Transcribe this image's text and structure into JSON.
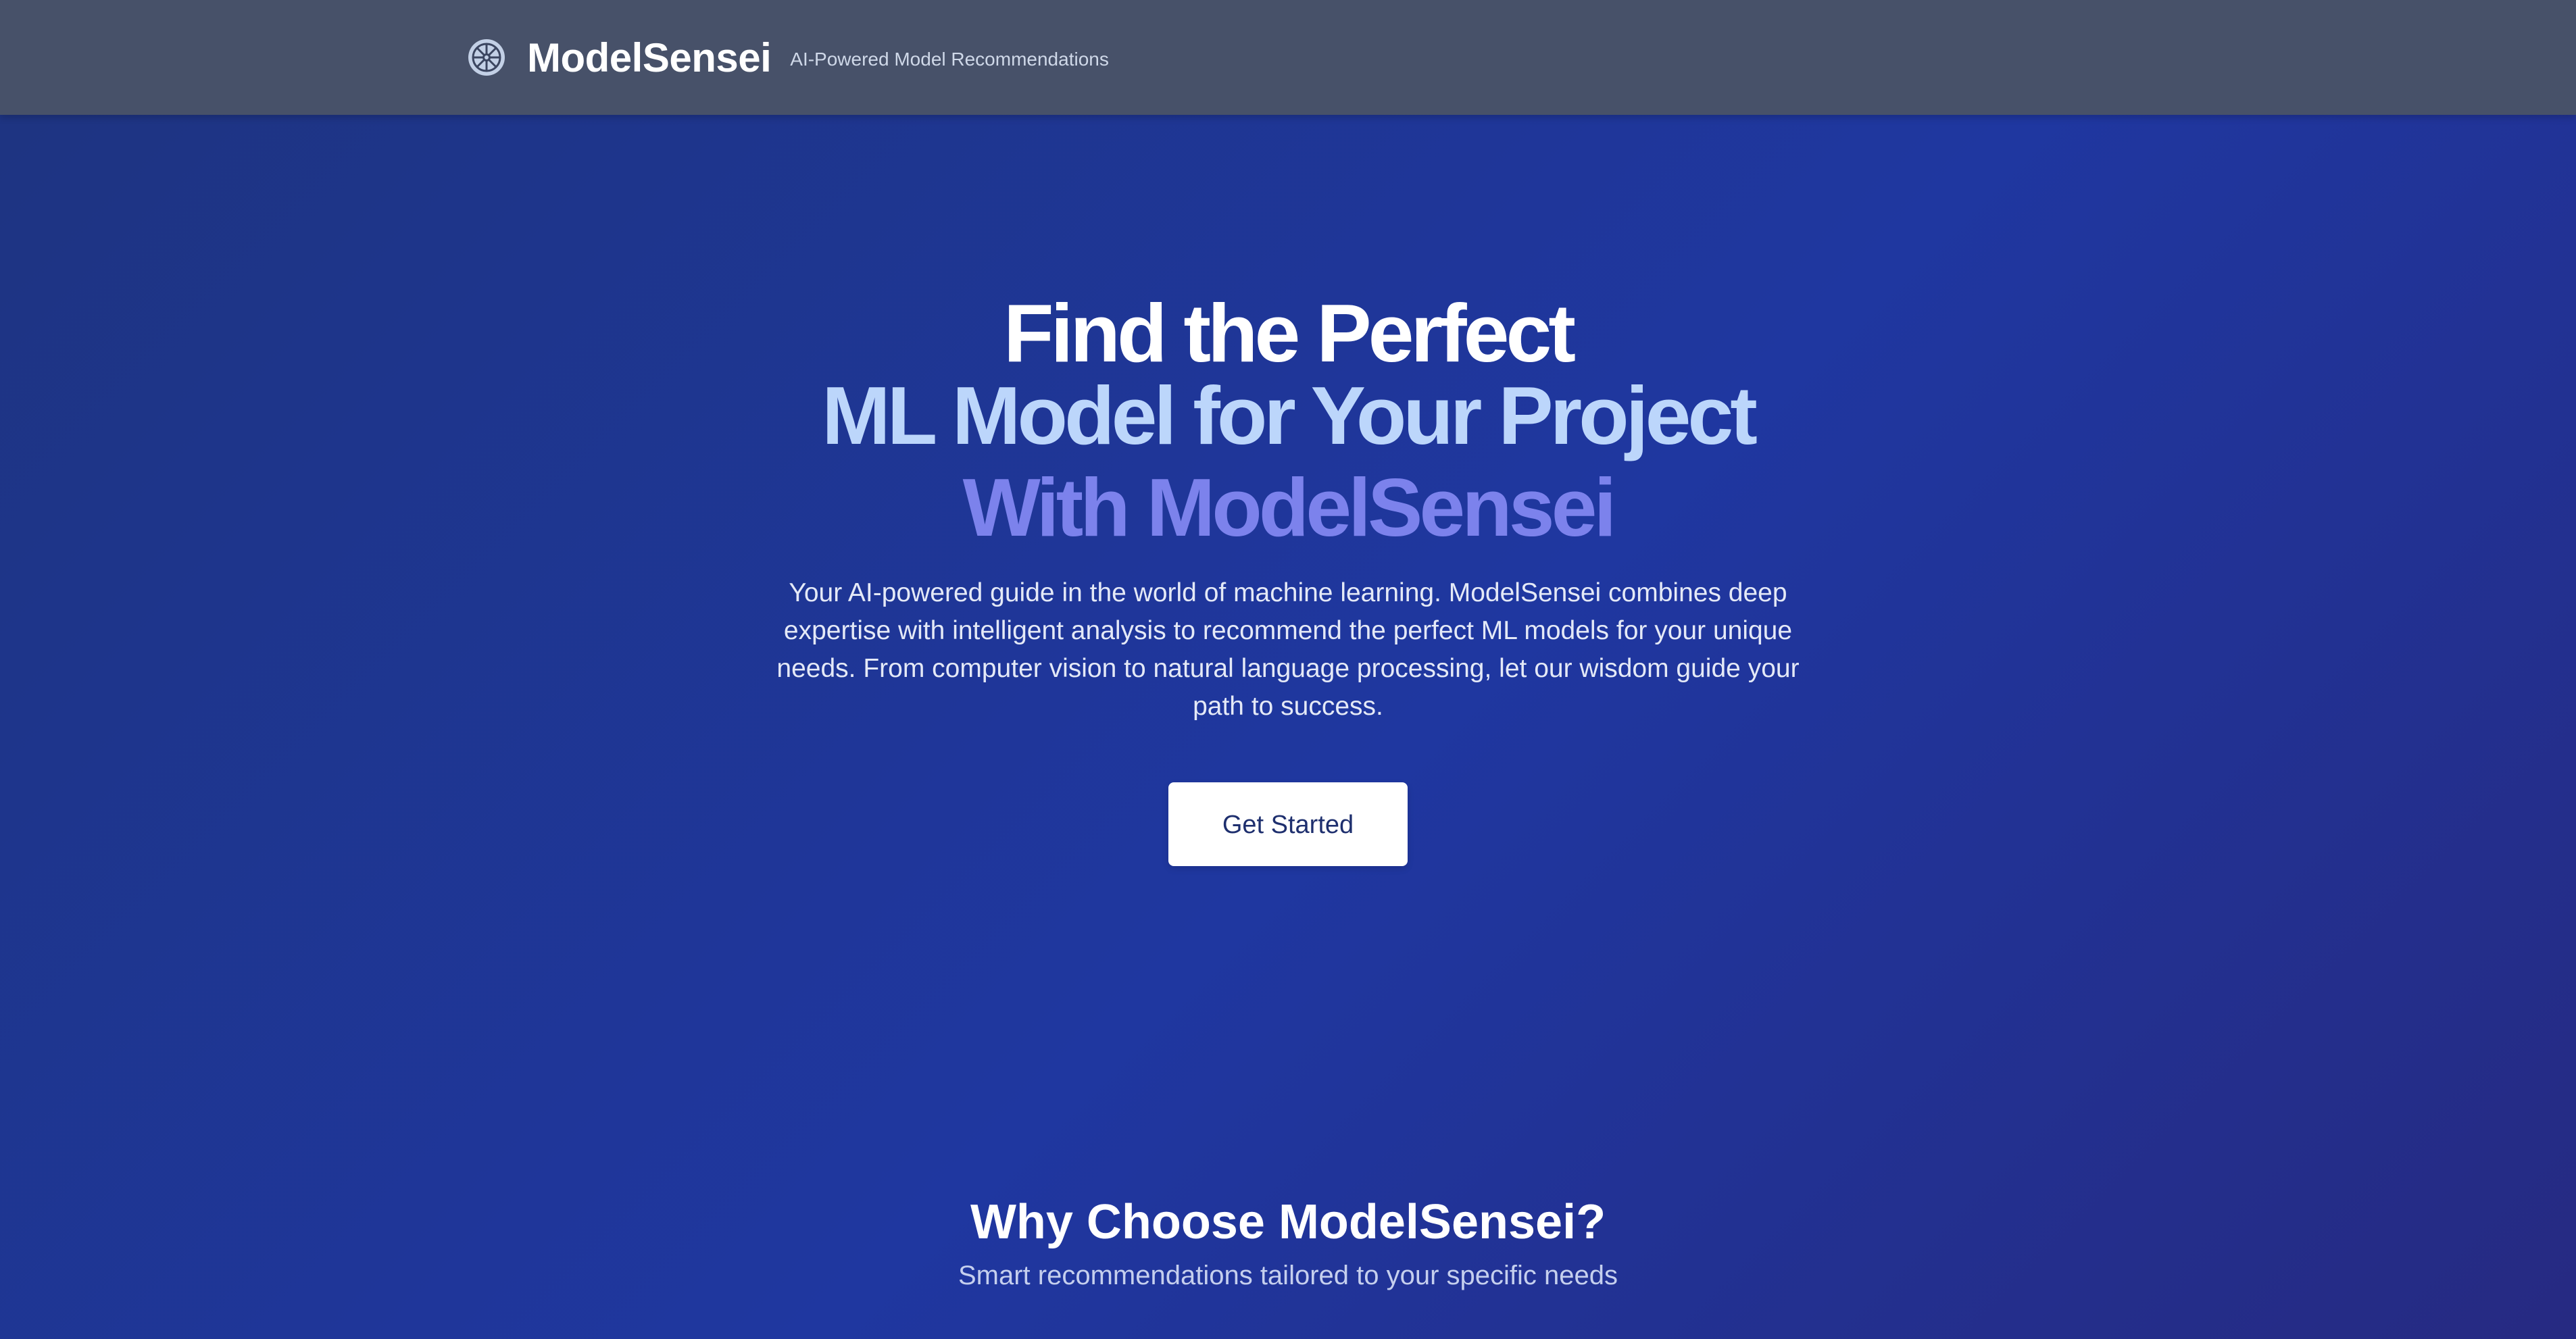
{
  "header": {
    "brand_name": "ModelSensei",
    "tagline": "AI-Powered Model Recommendations",
    "logo_icon": "dharma-wheel-icon"
  },
  "hero": {
    "headline_line1": "Find the Perfect",
    "headline_line2": "ML Model for Your Project",
    "headline_line3": "With ModelSensei",
    "description": "Your AI-powered guide in the world of machine learning. ModelSensei combines deep expertise with intelligent analysis to recommend the perfect ML models for your unique needs. From computer vision to natural language processing, let our wisdom guide your path to success.",
    "cta_label": "Get Started"
  },
  "features": {
    "title": "Why Choose ModelSensei?",
    "subtitle": "Smart recommendations tailored to your specific needs"
  },
  "colors": {
    "header_bg": "#475169",
    "hero_bg_start": "#1e3480",
    "hero_bg_end": "#262a82",
    "headline_white": "#ffffff",
    "headline_light_blue": "#bcd6fb",
    "headline_violet": "#7c82ec",
    "cta_bg": "#ffffff",
    "cta_text": "#1e2f6e"
  }
}
